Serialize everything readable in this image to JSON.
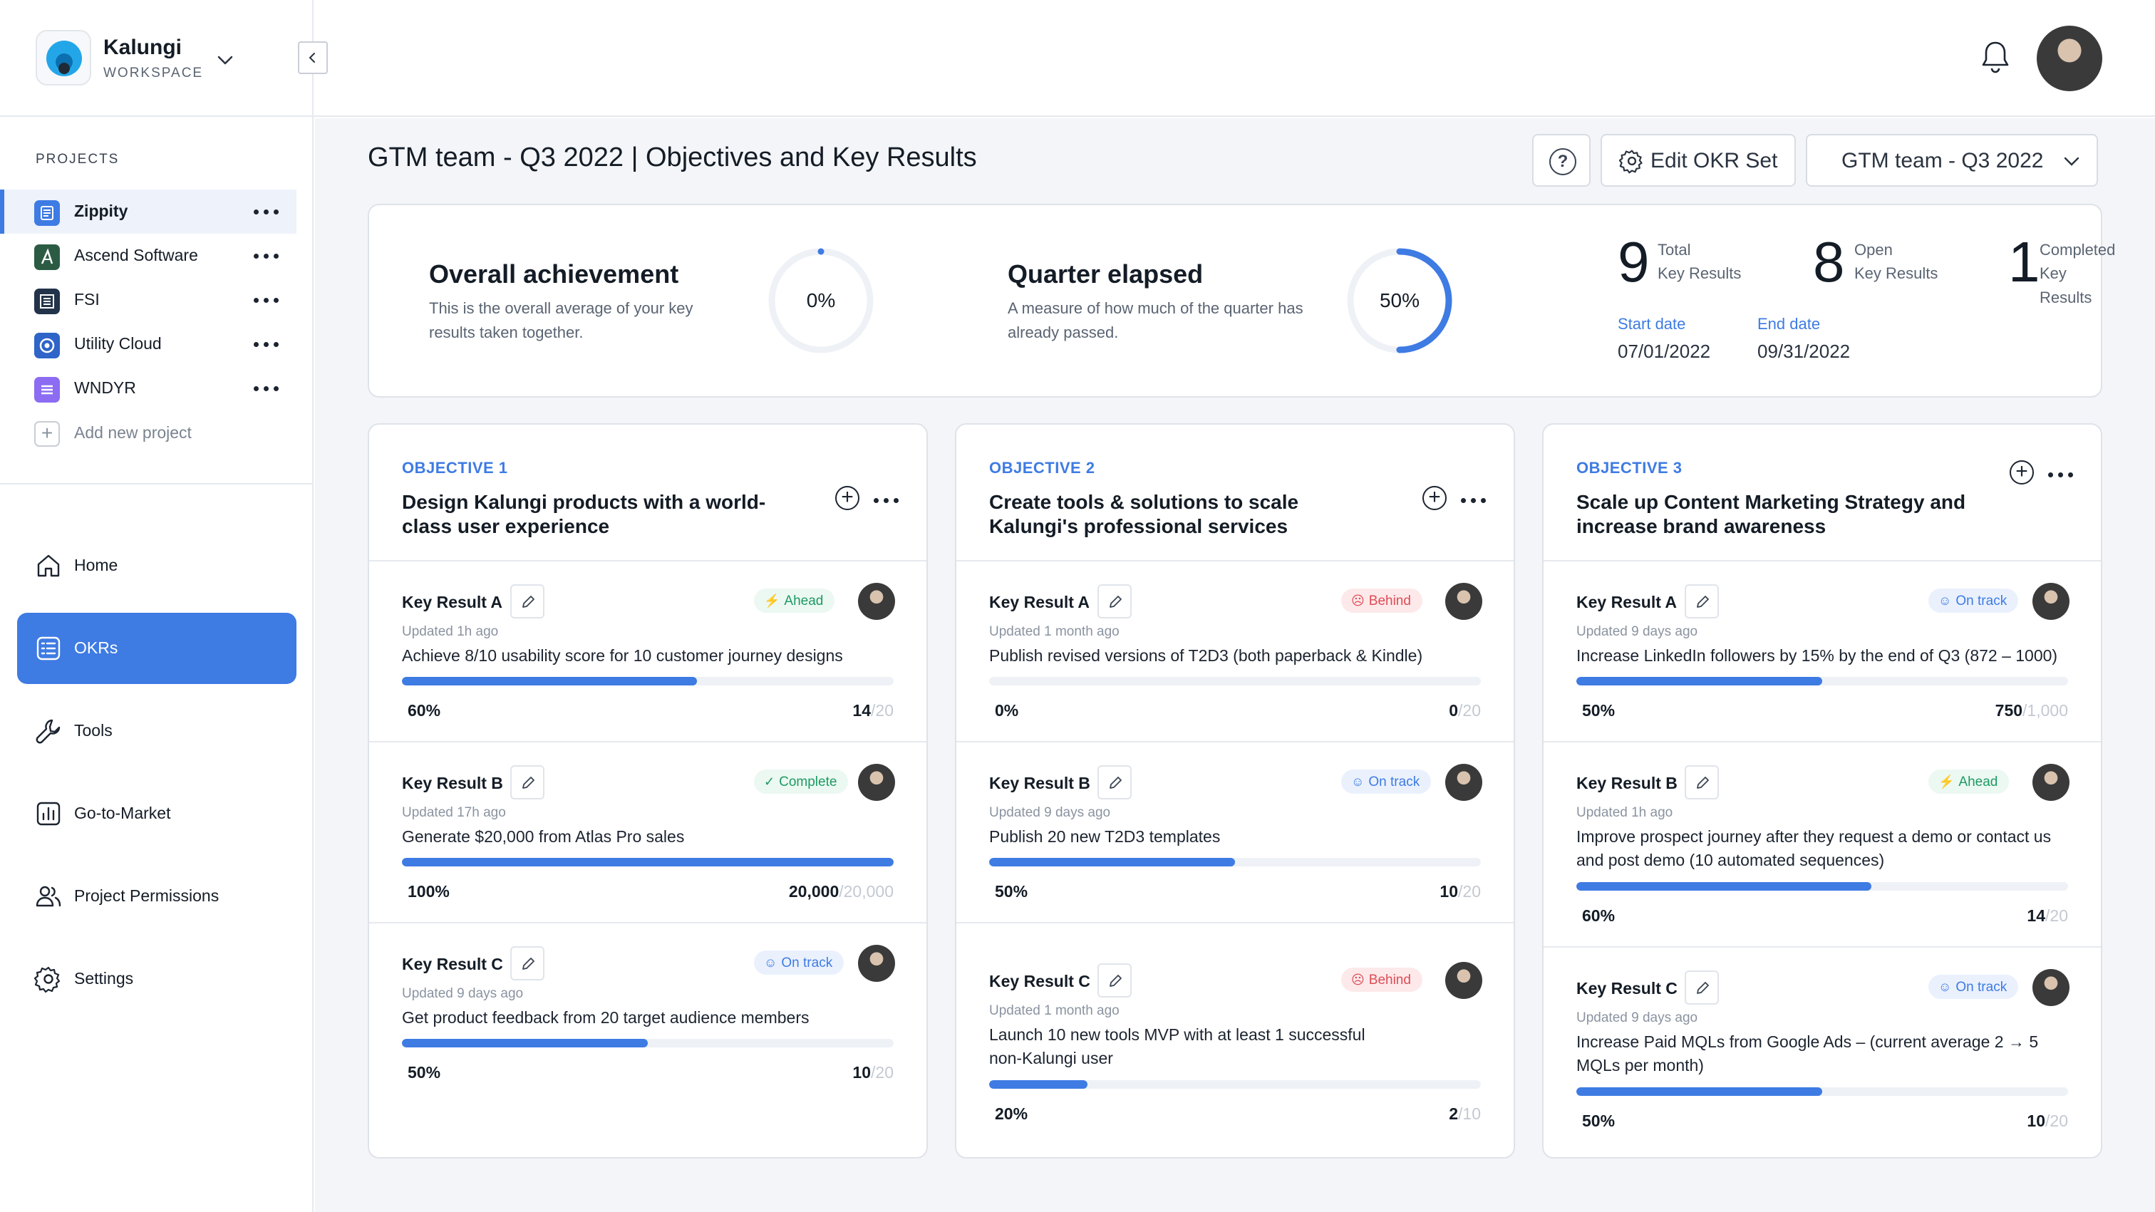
{
  "workspace": {
    "name": "Kalungi",
    "subtitle": "WORKSPACE"
  },
  "projects": {
    "title": "PROJECTS",
    "items": [
      {
        "label": "Zippity",
        "color": "#3e7be3",
        "active": true
      },
      {
        "label": "Ascend Software",
        "color": "#2c5b44",
        "active": false
      },
      {
        "label": "FSI",
        "color": "#22334a",
        "active": false
      },
      {
        "label": "Utility Cloud",
        "color": "#2f64c8",
        "active": false
      },
      {
        "label": "WNDYR",
        "color": "#7a5af0",
        "active": false
      }
    ],
    "add_label": "Add new project"
  },
  "nav": {
    "items": [
      {
        "label": "Home",
        "icon": "home-icon"
      },
      {
        "label": "OKRs",
        "icon": "list-icon",
        "active": true
      },
      {
        "label": "Tools",
        "icon": "wrench-icon"
      },
      {
        "label": "Go-to-Market",
        "icon": "chart-icon"
      },
      {
        "label": "Project Permissions",
        "icon": "users-icon"
      },
      {
        "label": "Settings",
        "icon": "gear-icon"
      }
    ]
  },
  "header": {
    "title": "GTM team - Q3 2022 | Objectives and Key Results",
    "edit_label": "Edit OKR Set",
    "period_label": "GTM team - Q3 2022"
  },
  "summary": {
    "achievement": {
      "title": "Overall achievement",
      "desc": "This is the overall average of your key results taken together.",
      "value": "0%",
      "fraction": 0
    },
    "elapsed": {
      "title": "Quarter elapsed",
      "desc": "A measure of how much of the quarter has already passed.",
      "value": "50%",
      "fraction": 0.5
    },
    "total": {
      "num": "9",
      "l1": "Total",
      "l2": "Key Results"
    },
    "open": {
      "num": "8",
      "l1": "Open",
      "l2": "Key Results"
    },
    "completed": {
      "num": "1",
      "l1": "Completed",
      "l2": "Key Results"
    },
    "start_label": "Start date",
    "start_value": "07/01/2022",
    "end_label": "End date",
    "end_value": "09/31/2022"
  },
  "objectives": [
    {
      "label": "OBJECTIVE 1",
      "title": "Design Kalungi products with a world-class user experience",
      "krs": [
        {
          "name": "Key Result A",
          "status": "Ahead",
          "status_type": "ahead",
          "updated": "Updated 1h ago",
          "desc": "Achieve 8/10 usability score for 10 customer journey designs",
          "progress": 0.6,
          "pct": "60%",
          "value": "14",
          "target": "/20"
        },
        {
          "name": "Key Result B",
          "status": "Complete",
          "status_type": "complete",
          "updated": "Updated 17h ago",
          "desc": "Generate $20,000 from Atlas Pro sales",
          "progress": 1.0,
          "pct": "100%",
          "value": "20,000",
          "target": "/20,000"
        },
        {
          "name": "Key Result C",
          "status": "On track",
          "status_type": "ontrack",
          "updated": "Updated 9 days ago",
          "desc": "Get product feedback from 20 target audience members",
          "progress": 0.5,
          "pct": "50%",
          "value": "10",
          "target": "/20"
        }
      ]
    },
    {
      "label": "OBJECTIVE 2",
      "title": "Create tools & solutions to scale Kalungi's professional services",
      "krs": [
        {
          "name": "Key Result A",
          "status": "Behind",
          "status_type": "behind",
          "updated": "Updated 1 month ago",
          "desc": "Publish revised versions of T2D3 (both paperback & Kindle)",
          "progress": 0,
          "pct": "0%",
          "value": "0",
          "target": "/20"
        },
        {
          "name": "Key Result B",
          "status": "On track",
          "status_type": "ontrack",
          "updated": "Updated 9 days ago",
          "desc": "Publish 20 new T2D3 templates",
          "progress": 0.5,
          "pct": "50%",
          "value": "10",
          "target": "/20"
        },
        {
          "name": "Key Result C",
          "status": "Behind",
          "status_type": "behind",
          "updated": "Updated 1 month ago",
          "desc": "Launch 10 new tools MVP with at least 1 successful non-Kalungi user",
          "progress": 0.2,
          "pct": "20%",
          "value": "2",
          "target": "/10"
        }
      ]
    },
    {
      "label": "OBJECTIVE 3",
      "title": "Scale up Content Marketing Strategy and increase brand awareness",
      "krs": [
        {
          "name": "Key Result A",
          "status": "On track",
          "status_type": "ontrack",
          "updated": "Updated 9 days ago",
          "desc": "Increase LinkedIn followers by 15% by the end of Q3 (872 – 1000)",
          "progress": 0.5,
          "pct": "50%",
          "value": "750",
          "target": "/1,000"
        },
        {
          "name": "Key Result B",
          "status": "Ahead",
          "status_type": "ahead",
          "updated": "Updated 1h ago",
          "desc": "Improve prospect journey after they request a demo or contact us and post demo (10 automated sequences)",
          "progress": 0.6,
          "pct": "60%",
          "value": "14",
          "target": "/20"
        },
        {
          "name": "Key Result C",
          "status": "On track",
          "status_type": "ontrack",
          "updated": "Updated 9 days ago",
          "desc": "Increase Paid MQLs from Google Ads – (current average 2 → 5 MQLs per month)",
          "progress": 0.5,
          "pct": "50%",
          "value": "10",
          "target": "/20"
        }
      ]
    }
  ],
  "colors": {
    "accent": "#3e7be3",
    "ahead": "#1e9a63",
    "behind": "#e04b55"
  }
}
